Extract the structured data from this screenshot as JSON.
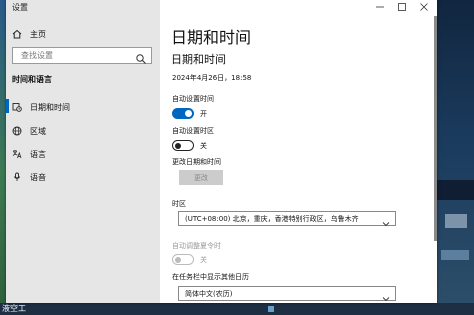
{
  "desktop": {
    "bottom_label": "液空工"
  },
  "window": {
    "app_title": "设置",
    "controls": {
      "minimize": "—",
      "maximize": "☐",
      "close": "✕"
    }
  },
  "sidebar": {
    "home_label": "主页",
    "search_placeholder": "查找设置",
    "section_title": "时间和语言",
    "items": [
      {
        "label": "日期和时间",
        "icon": "calendar-clock-icon",
        "selected": true
      },
      {
        "label": "区域",
        "icon": "globe-icon",
        "selected": false
      },
      {
        "label": "语言",
        "icon": "language-icon",
        "selected": false
      },
      {
        "label": "语音",
        "icon": "microphone-icon",
        "selected": false
      }
    ]
  },
  "main": {
    "page_title": "日期和时间",
    "section_title": "日期和时间",
    "current_datetime": "2024年4月26日，18:58",
    "auto_time": {
      "label": "自动设置时间",
      "state_text": "开",
      "on": true
    },
    "auto_timezone": {
      "label": "自动设置时区",
      "state_text": "关",
      "on": false
    },
    "change_datetime": {
      "label": "更改日期和时间",
      "button": "更改"
    },
    "timezone": {
      "label": "时区",
      "value": "(UTC+08:00) 北京，重庆，香港特别行政区，乌鲁木齐"
    },
    "dst": {
      "label": "自动调整夏令时",
      "state_text": "关",
      "disabled": true
    },
    "extra_calendar": {
      "label": "在任务栏中显示其他日历",
      "value": "简体中文(农历)"
    }
  },
  "colors": {
    "accent": "#0067c0",
    "sidebar_bg": "#e6e6e6",
    "disabled": "#9a9a9a"
  }
}
